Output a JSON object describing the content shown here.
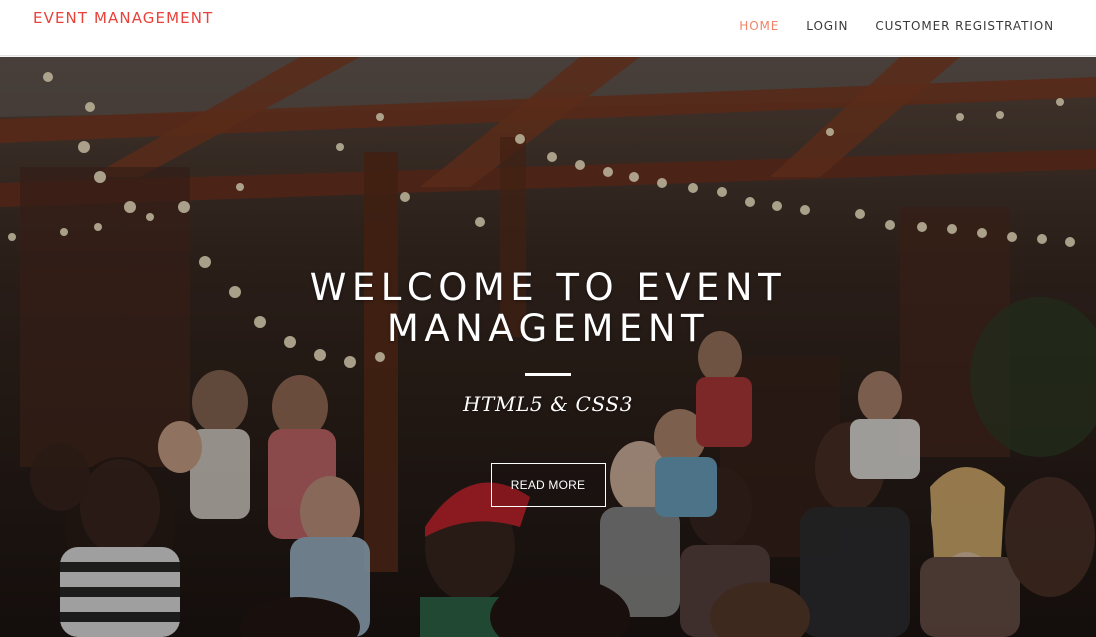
{
  "header": {
    "brand": "EVENT MANAGEMENT",
    "brand_color": "#e8423b",
    "nav": [
      {
        "label": "HOME",
        "active": true
      },
      {
        "label": "LOGIN",
        "active": false
      },
      {
        "label": "CUSTOMER REGISTRATION",
        "active": false
      }
    ],
    "active_color": "#f08468"
  },
  "hero": {
    "title": "WELCOME TO EVENT MANAGEMENT",
    "subtitle": "HTML5 & CSS3",
    "button_label": "READ MORE",
    "background": "photo of people at an outdoor party under a wooden pergola with string lights"
  }
}
